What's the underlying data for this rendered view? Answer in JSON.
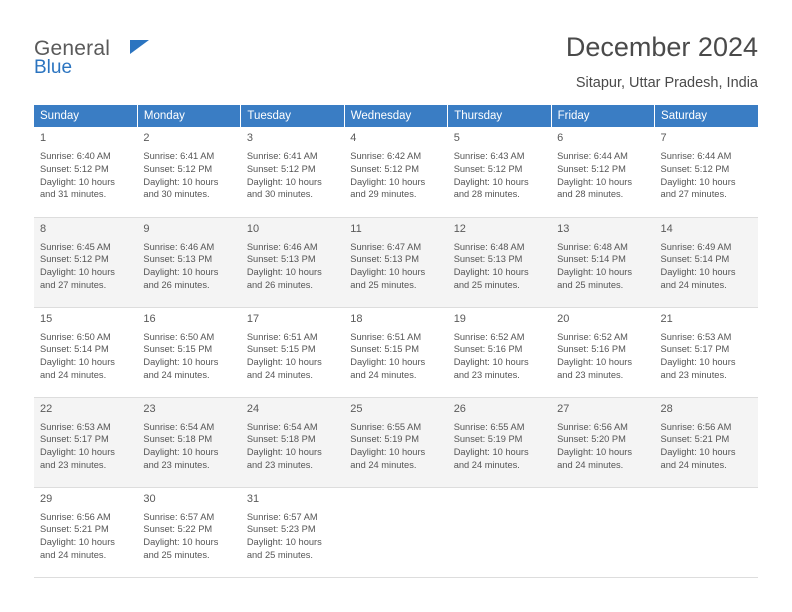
{
  "brand": {
    "line1": "General",
    "line2": "Blue",
    "flag_icon": "blue-flag-icon"
  },
  "header": {
    "month_title": "December 2024",
    "location": "Sitapur, Uttar Pradesh, India"
  },
  "colors": {
    "accent": "#3a7dc4",
    "brand_blue": "#2b74c0",
    "alt_row": "#f4f4f4"
  },
  "weekdays": [
    "Sunday",
    "Monday",
    "Tuesday",
    "Wednesday",
    "Thursday",
    "Friday",
    "Saturday"
  ],
  "labels": {
    "sunrise": "Sunrise:",
    "sunset": "Sunset:",
    "daylight": "Daylight:"
  },
  "weeks": [
    [
      {
        "day": "1",
        "sunrise": "Sunrise: 6:40 AM",
        "sunset": "Sunset: 5:12 PM",
        "daylight1": "Daylight: 10 hours",
        "daylight2": "and 31 minutes."
      },
      {
        "day": "2",
        "sunrise": "Sunrise: 6:41 AM",
        "sunset": "Sunset: 5:12 PM",
        "daylight1": "Daylight: 10 hours",
        "daylight2": "and 30 minutes."
      },
      {
        "day": "3",
        "sunrise": "Sunrise: 6:41 AM",
        "sunset": "Sunset: 5:12 PM",
        "daylight1": "Daylight: 10 hours",
        "daylight2": "and 30 minutes."
      },
      {
        "day": "4",
        "sunrise": "Sunrise: 6:42 AM",
        "sunset": "Sunset: 5:12 PM",
        "daylight1": "Daylight: 10 hours",
        "daylight2": "and 29 minutes."
      },
      {
        "day": "5",
        "sunrise": "Sunrise: 6:43 AM",
        "sunset": "Sunset: 5:12 PM",
        "daylight1": "Daylight: 10 hours",
        "daylight2": "and 28 minutes."
      },
      {
        "day": "6",
        "sunrise": "Sunrise: 6:44 AM",
        "sunset": "Sunset: 5:12 PM",
        "daylight1": "Daylight: 10 hours",
        "daylight2": "and 28 minutes."
      },
      {
        "day": "7",
        "sunrise": "Sunrise: 6:44 AM",
        "sunset": "Sunset: 5:12 PM",
        "daylight1": "Daylight: 10 hours",
        "daylight2": "and 27 minutes."
      }
    ],
    [
      {
        "day": "8",
        "sunrise": "Sunrise: 6:45 AM",
        "sunset": "Sunset: 5:12 PM",
        "daylight1": "Daylight: 10 hours",
        "daylight2": "and 27 minutes."
      },
      {
        "day": "9",
        "sunrise": "Sunrise: 6:46 AM",
        "sunset": "Sunset: 5:13 PM",
        "daylight1": "Daylight: 10 hours",
        "daylight2": "and 26 minutes."
      },
      {
        "day": "10",
        "sunrise": "Sunrise: 6:46 AM",
        "sunset": "Sunset: 5:13 PM",
        "daylight1": "Daylight: 10 hours",
        "daylight2": "and 26 minutes."
      },
      {
        "day": "11",
        "sunrise": "Sunrise: 6:47 AM",
        "sunset": "Sunset: 5:13 PM",
        "daylight1": "Daylight: 10 hours",
        "daylight2": "and 25 minutes."
      },
      {
        "day": "12",
        "sunrise": "Sunrise: 6:48 AM",
        "sunset": "Sunset: 5:13 PM",
        "daylight1": "Daylight: 10 hours",
        "daylight2": "and 25 minutes."
      },
      {
        "day": "13",
        "sunrise": "Sunrise: 6:48 AM",
        "sunset": "Sunset: 5:14 PM",
        "daylight1": "Daylight: 10 hours",
        "daylight2": "and 25 minutes."
      },
      {
        "day": "14",
        "sunrise": "Sunrise: 6:49 AM",
        "sunset": "Sunset: 5:14 PM",
        "daylight1": "Daylight: 10 hours",
        "daylight2": "and 24 minutes."
      }
    ],
    [
      {
        "day": "15",
        "sunrise": "Sunrise: 6:50 AM",
        "sunset": "Sunset: 5:14 PM",
        "daylight1": "Daylight: 10 hours",
        "daylight2": "and 24 minutes."
      },
      {
        "day": "16",
        "sunrise": "Sunrise: 6:50 AM",
        "sunset": "Sunset: 5:15 PM",
        "daylight1": "Daylight: 10 hours",
        "daylight2": "and 24 minutes."
      },
      {
        "day": "17",
        "sunrise": "Sunrise: 6:51 AM",
        "sunset": "Sunset: 5:15 PM",
        "daylight1": "Daylight: 10 hours",
        "daylight2": "and 24 minutes."
      },
      {
        "day": "18",
        "sunrise": "Sunrise: 6:51 AM",
        "sunset": "Sunset: 5:15 PM",
        "daylight1": "Daylight: 10 hours",
        "daylight2": "and 24 minutes."
      },
      {
        "day": "19",
        "sunrise": "Sunrise: 6:52 AM",
        "sunset": "Sunset: 5:16 PM",
        "daylight1": "Daylight: 10 hours",
        "daylight2": "and 23 minutes."
      },
      {
        "day": "20",
        "sunrise": "Sunrise: 6:52 AM",
        "sunset": "Sunset: 5:16 PM",
        "daylight1": "Daylight: 10 hours",
        "daylight2": "and 23 minutes."
      },
      {
        "day": "21",
        "sunrise": "Sunrise: 6:53 AM",
        "sunset": "Sunset: 5:17 PM",
        "daylight1": "Daylight: 10 hours",
        "daylight2": "and 23 minutes."
      }
    ],
    [
      {
        "day": "22",
        "sunrise": "Sunrise: 6:53 AM",
        "sunset": "Sunset: 5:17 PM",
        "daylight1": "Daylight: 10 hours",
        "daylight2": "and 23 minutes."
      },
      {
        "day": "23",
        "sunrise": "Sunrise: 6:54 AM",
        "sunset": "Sunset: 5:18 PM",
        "daylight1": "Daylight: 10 hours",
        "daylight2": "and 23 minutes."
      },
      {
        "day": "24",
        "sunrise": "Sunrise: 6:54 AM",
        "sunset": "Sunset: 5:18 PM",
        "daylight1": "Daylight: 10 hours",
        "daylight2": "and 23 minutes."
      },
      {
        "day": "25",
        "sunrise": "Sunrise: 6:55 AM",
        "sunset": "Sunset: 5:19 PM",
        "daylight1": "Daylight: 10 hours",
        "daylight2": "and 24 minutes."
      },
      {
        "day": "26",
        "sunrise": "Sunrise: 6:55 AM",
        "sunset": "Sunset: 5:19 PM",
        "daylight1": "Daylight: 10 hours",
        "daylight2": "and 24 minutes."
      },
      {
        "day": "27",
        "sunrise": "Sunrise: 6:56 AM",
        "sunset": "Sunset: 5:20 PM",
        "daylight1": "Daylight: 10 hours",
        "daylight2": "and 24 minutes."
      },
      {
        "day": "28",
        "sunrise": "Sunrise: 6:56 AM",
        "sunset": "Sunset: 5:21 PM",
        "daylight1": "Daylight: 10 hours",
        "daylight2": "and 24 minutes."
      }
    ],
    [
      {
        "day": "29",
        "sunrise": "Sunrise: 6:56 AM",
        "sunset": "Sunset: 5:21 PM",
        "daylight1": "Daylight: 10 hours",
        "daylight2": "and 24 minutes."
      },
      {
        "day": "30",
        "sunrise": "Sunrise: 6:57 AM",
        "sunset": "Sunset: 5:22 PM",
        "daylight1": "Daylight: 10 hours",
        "daylight2": "and 25 minutes."
      },
      {
        "day": "31",
        "sunrise": "Sunrise: 6:57 AM",
        "sunset": "Sunset: 5:23 PM",
        "daylight1": "Daylight: 10 hours",
        "daylight2": "and 25 minutes."
      },
      {
        "day": "",
        "sunrise": "",
        "sunset": "",
        "daylight1": "",
        "daylight2": ""
      },
      {
        "day": "",
        "sunrise": "",
        "sunset": "",
        "daylight1": "",
        "daylight2": ""
      },
      {
        "day": "",
        "sunrise": "",
        "sunset": "",
        "daylight1": "",
        "daylight2": ""
      },
      {
        "day": "",
        "sunrise": "",
        "sunset": "",
        "daylight1": "",
        "daylight2": ""
      }
    ]
  ]
}
